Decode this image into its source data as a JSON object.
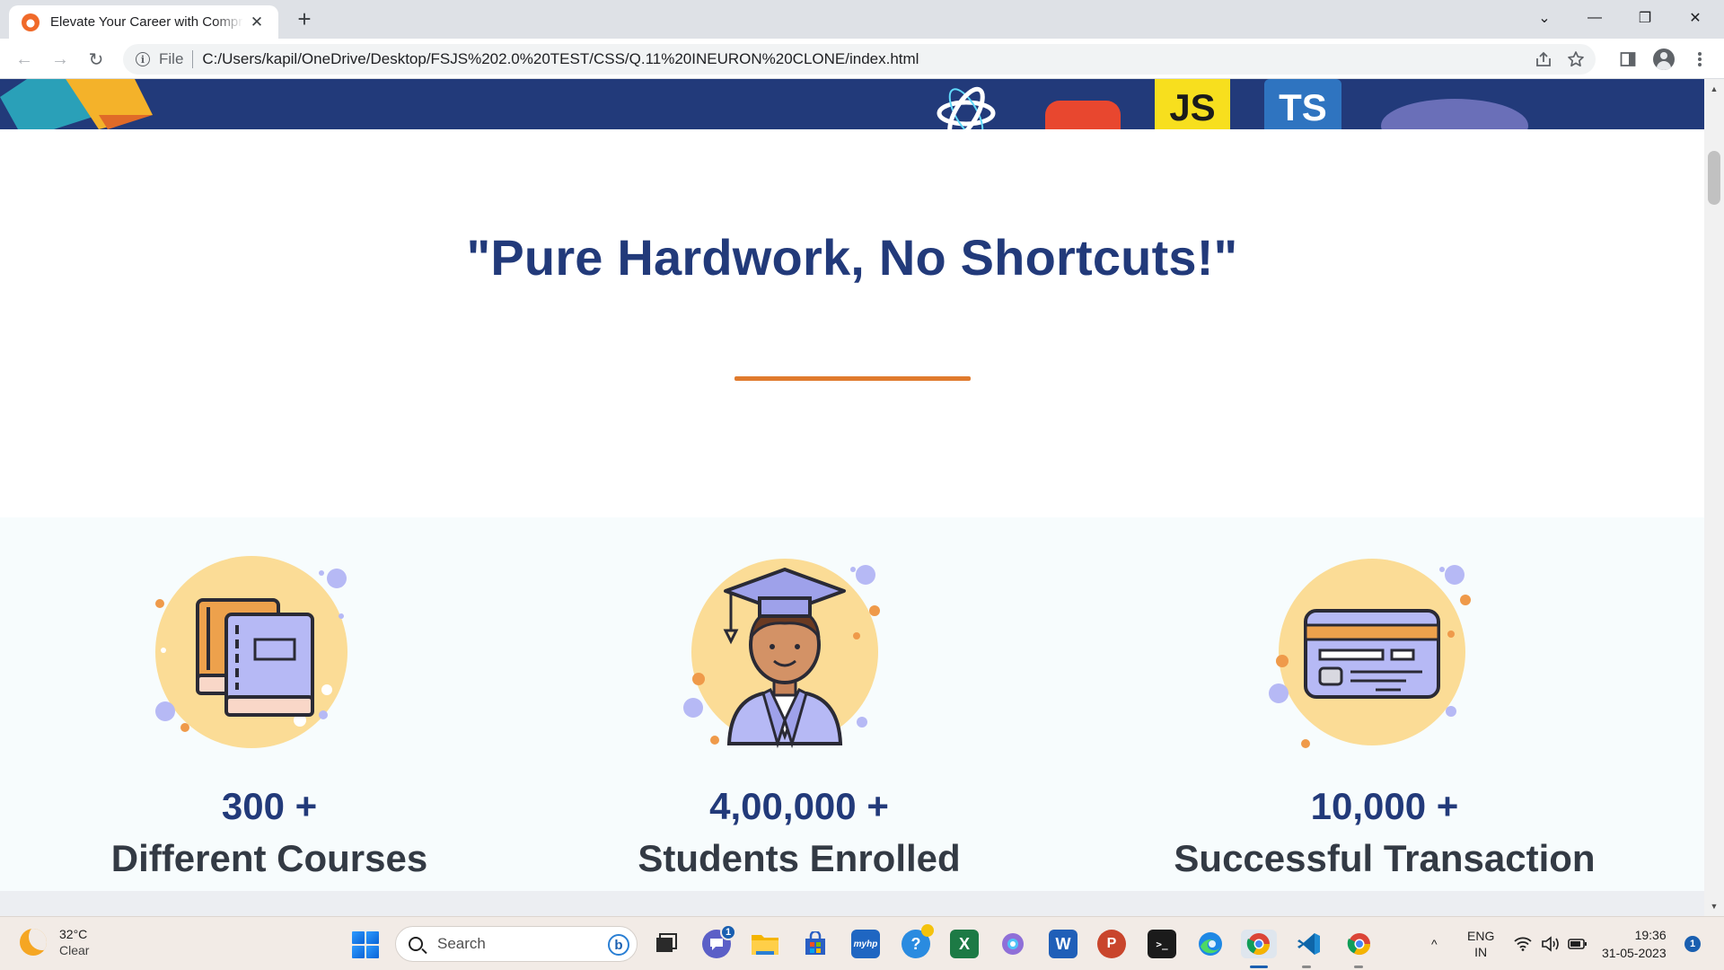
{
  "browser": {
    "tab_title": "Elevate Your Career with Compre",
    "new_tab_symbol": "+",
    "close_symbol": "✕",
    "scheme_label": "File",
    "url": "C:/Users/kapil/OneDrive/Desktop/FSJS%202.0%20TEST/CSS/Q.11%20INEURON%20CLONE/index.html",
    "back_symbol": "←",
    "forward_symbol": "→",
    "reload_symbol": "↻",
    "info_symbol": "i",
    "window_controls": {
      "dropdown": "⌄",
      "minimize": "—",
      "restore": "❐",
      "close": "✕"
    }
  },
  "page": {
    "hero_logos": {
      "js_label": "JS",
      "ts_label": "TS"
    },
    "quote": "\"Pure Hardwork, No Shortcuts!\"",
    "stats": [
      {
        "number": "300 +",
        "label": "Different Courses",
        "icon": "books-icon"
      },
      {
        "number": "4,00,000 +",
        "label": "Students Enrolled",
        "icon": "graduate-icon"
      },
      {
        "number": "10,000 +",
        "label": "Successful Transaction",
        "icon": "credit-card-icon"
      }
    ],
    "colors": {
      "navy": "#223a7a",
      "accent": "#e07b2e",
      "stat_band": "#f7fcfd",
      "icon_circle": "#fbdc96",
      "icon_purple": "#b6b9f5"
    }
  },
  "taskbar": {
    "weather": {
      "temp": "32°C",
      "condition": "Clear"
    },
    "search_placeholder": "Search",
    "bing_label": "b",
    "teams_badge": "1",
    "myhp_label": "myhp",
    "excel_label": "X",
    "word_label": "W",
    "ppt_label": "P",
    "terminal_label": ">_",
    "tray_chevron": "^",
    "language": {
      "line1": "ENG",
      "line2": "IN"
    },
    "time": "19:36",
    "date": "31-05-2023",
    "notification_count": "1"
  }
}
